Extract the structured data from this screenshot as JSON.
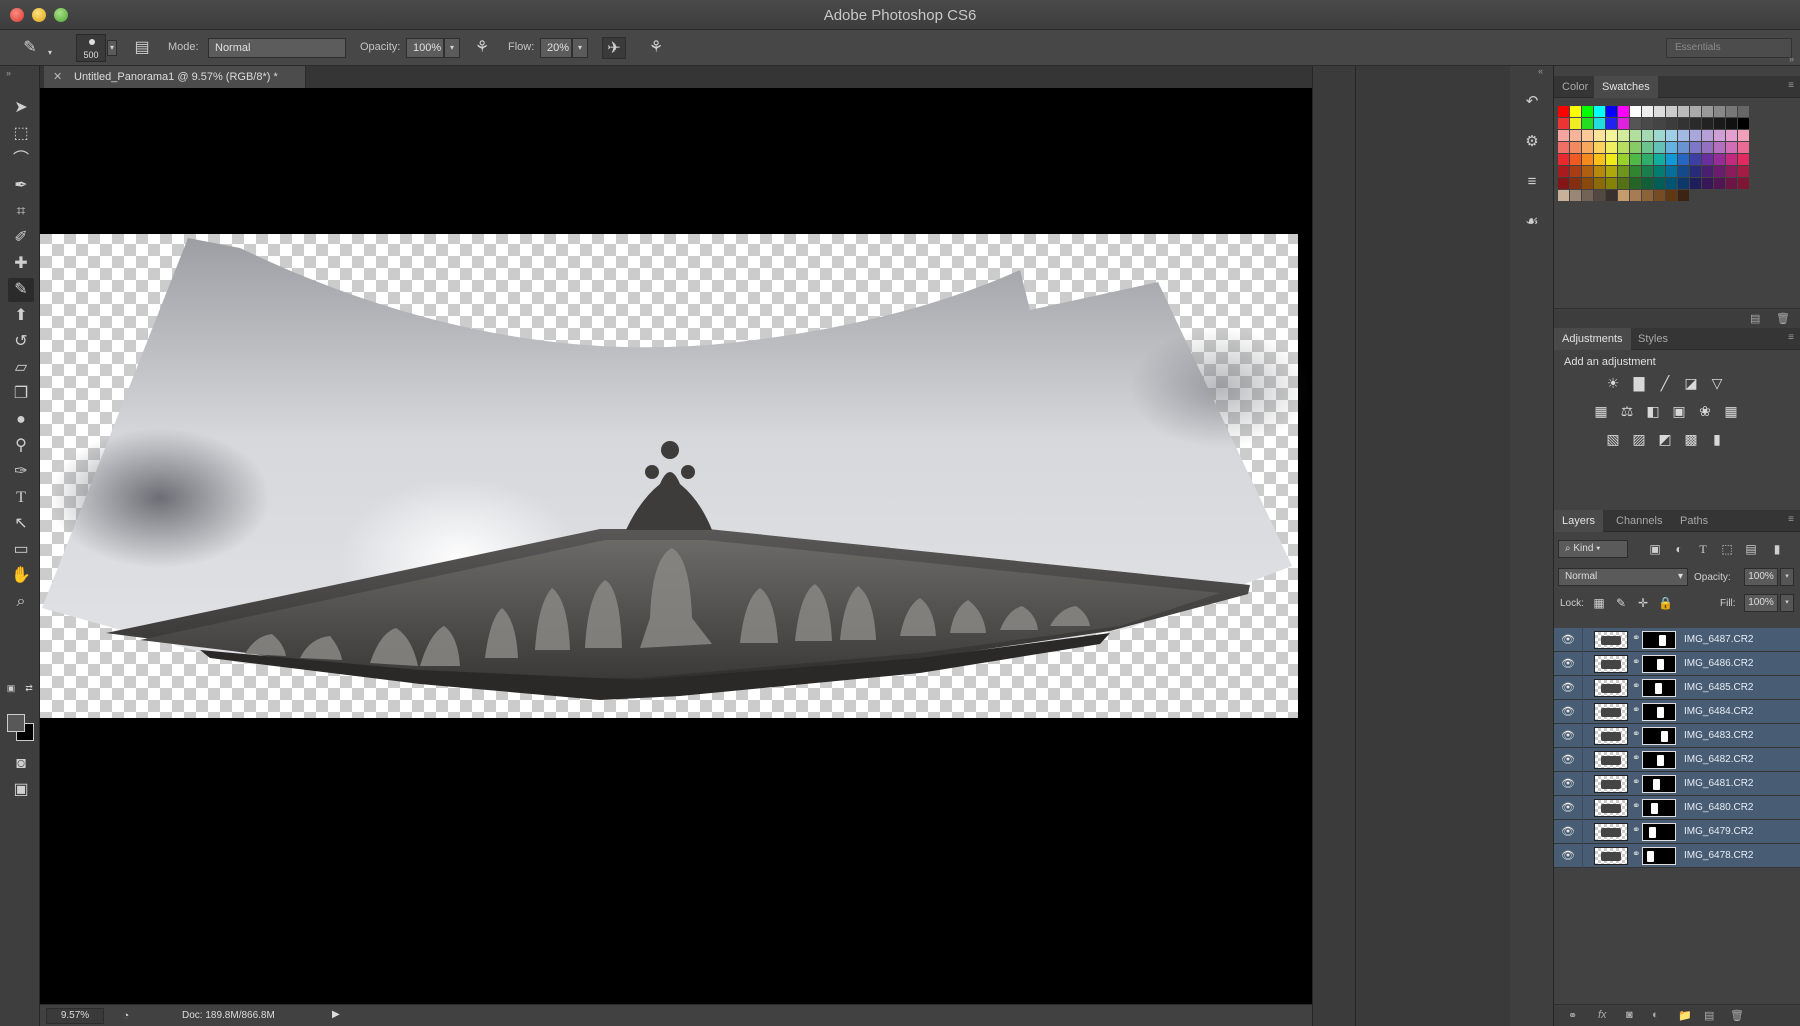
{
  "window": {
    "title": "Adobe Photoshop CS6"
  },
  "options_bar": {
    "brush_size": "500",
    "mode_label": "Mode:",
    "mode_value": "Normal",
    "opacity_label": "Opacity:",
    "opacity_value": "100%",
    "flow_label": "Flow:",
    "flow_value": "20%",
    "workspace": "Essentials"
  },
  "document": {
    "tab_title": "Untitled_Panorama1 @ 9.57% (RGB/8*) *",
    "zoom": "9.57%",
    "doc_info": "Doc: 189.8M/866.8M"
  },
  "tools": [
    "move-tool",
    "marquee-tool",
    "lasso-tool",
    "quick-selection-tool",
    "crop-tool",
    "eyedropper-tool",
    "spot-healing-tool",
    "brush-tool",
    "clone-stamp-tool",
    "history-brush-tool",
    "eraser-tool",
    "paint-bucket-tool",
    "blur-tool",
    "dodge-tool",
    "pen-tool",
    "type-tool",
    "path-selection-tool",
    "rectangle-tool",
    "hand-tool",
    "zoom-tool"
  ],
  "panels": {
    "color_tabs": {
      "color": "Color",
      "swatches": "Swatches"
    },
    "adjustment_tabs": {
      "adjustments": "Adjustments",
      "styles": "Styles"
    },
    "adjustments_heading": "Add an adjustment",
    "layer_tabs": {
      "layers": "Layers",
      "channels": "Channels",
      "paths": "Paths"
    },
    "kind_filter": "Kind",
    "blend_mode": "Normal",
    "opacity_label": "Opacity:",
    "opacity_value": "100%",
    "lock_label": "Lock:",
    "fill_label": "Fill:",
    "fill_value": "100%"
  },
  "swatch_colors": [
    [
      "#ff0000",
      "#ffff00",
      "#00ff00",
      "#00ffff",
      "#0000ff",
      "#ff00ff",
      "#ffffff",
      "#eeeeee",
      "#dddddd",
      "#cccccc",
      "#bbbbbb",
      "#aaaaaa",
      "#999999",
      "#888888",
      "#777777",
      "#666666"
    ],
    [
      "#ee3333",
      "#eeee22",
      "#22dd22",
      "#22dddd",
      "#2222ee",
      "#dd22dd",
      "#555555",
      "#4a4a4a",
      "#444444",
      "#3c3c3c",
      "#333333",
      "#2a2a2a",
      "#222222",
      "#1a1a1a",
      "#111111",
      "#000000"
    ],
    [
      "#f4a5a0",
      "#f7b49a",
      "#fbc99a",
      "#fde49a",
      "#f4f39a",
      "#d2eb9c",
      "#b0df9e",
      "#a3d9b3",
      "#9fd8d0",
      "#9fcfe8",
      "#a2b9e3",
      "#a9a6dc",
      "#b79fd8",
      "#cf9fd6",
      "#e49fd0",
      "#f2a0b9"
    ],
    [
      "#ef6f67",
      "#f3895f",
      "#f9a75c",
      "#fcd25c",
      "#f0ee5c",
      "#b8de60",
      "#86cc66",
      "#6cc38d",
      "#62c2b7",
      "#62b3e0",
      "#6993d3",
      "#7c78c7",
      "#9570c1",
      "#b46fbf",
      "#d36db5",
      "#ea6c94"
    ],
    [
      "#e8292e",
      "#ee5a22",
      "#f5891d",
      "#fbbf1a",
      "#efeb19",
      "#98d12a",
      "#4fb847",
      "#2fad6b",
      "#12ad9f",
      "#1299d5",
      "#2566c0",
      "#3e3fa6",
      "#6a2f9c",
      "#962c97",
      "#c3297f",
      "#e32a5e"
    ],
    [
      "#a81c1e",
      "#ab3d16",
      "#b05f10",
      "#b6890c",
      "#ada90c",
      "#6e951c",
      "#318430",
      "#1a7d4c",
      "#057c72",
      "#056e99",
      "#144a8c",
      "#292a78",
      "#4b1f70",
      "#6b1d6d",
      "#8c1b5b",
      "#a31c42"
    ],
    [
      "#831516",
      "#852e10",
      "#88490a",
      "#8c6a07",
      "#858307",
      "#547215",
      "#236524",
      "#105f39",
      "#015e56",
      "#015374",
      "#0c386a",
      "#1d1e5b",
      "#381755",
      "#511553",
      "#6b1445",
      "#7e1532"
    ],
    [
      "#c7b299",
      "#998675",
      "#736357",
      "#534741",
      "#37302c",
      "#c69c6d",
      "#a67c52",
      "#8c6239",
      "#754c24",
      "#603913",
      "#3c2415"
    ]
  ],
  "layers": [
    {
      "name": "IMG_6487.CR2"
    },
    {
      "name": "IMG_6486.CR2"
    },
    {
      "name": "IMG_6485.CR2"
    },
    {
      "name": "IMG_6484.CR2"
    },
    {
      "name": "IMG_6483.CR2"
    },
    {
      "name": "IMG_6482.CR2"
    },
    {
      "name": "IMG_6481.CR2"
    },
    {
      "name": "IMG_6480.CR2"
    },
    {
      "name": "IMG_6479.CR2"
    },
    {
      "name": "IMG_6478.CR2"
    }
  ]
}
